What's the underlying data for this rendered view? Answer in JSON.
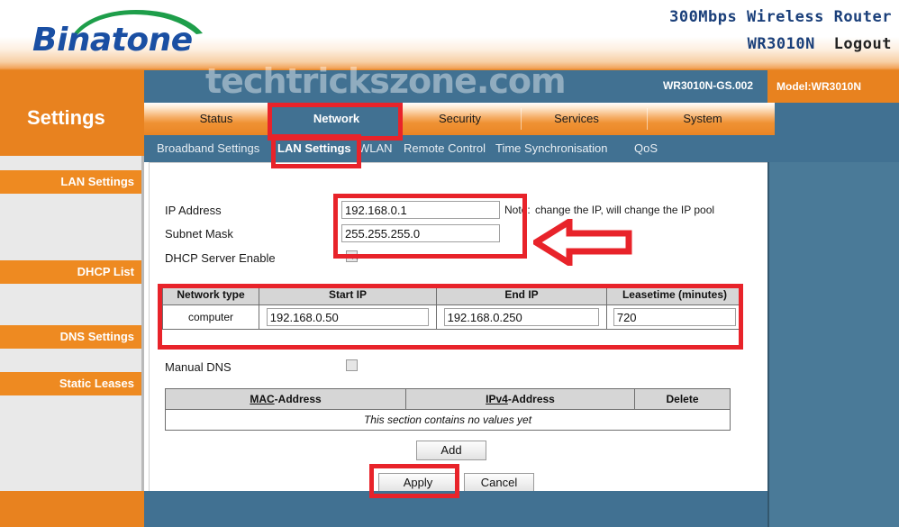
{
  "header": {
    "brand": "Binatone",
    "product_line1": "300Mbps Wireless Router",
    "product_line2": "WR3010N",
    "logout_label": "Logout"
  },
  "titlebar": {
    "watermark": "techtrickszone.com",
    "firmware_version": "WR3010N-GS.002",
    "model_label": "Model:WR3010N"
  },
  "settings_block": {
    "label": "Settings"
  },
  "main_nav": {
    "items": [
      {
        "label": "Status",
        "active": false
      },
      {
        "label": "Network",
        "active": true
      },
      {
        "label": "Security",
        "active": false
      },
      {
        "label": "Services",
        "active": false
      },
      {
        "label": "System",
        "active": false
      }
    ]
  },
  "sub_nav": {
    "items": [
      {
        "label": "Broadband Settings",
        "active": false
      },
      {
        "label": "LAN Settings",
        "active": true
      },
      {
        "label": "WLAN",
        "active": false
      },
      {
        "label": "Remote Control",
        "active": false
      },
      {
        "label": "Time Synchronisation",
        "active": false
      },
      {
        "label": "QoS",
        "active": false
      }
    ]
  },
  "sidebar": {
    "items": [
      {
        "label": "LAN Settings"
      },
      {
        "label": "DHCP List"
      },
      {
        "label": "DNS Settings"
      },
      {
        "label": "Static Leases"
      }
    ]
  },
  "form": {
    "ip_address_label": "IP Address",
    "ip_address_value": "192.168.0.1",
    "subnet_mask_label": "Subnet Mask",
    "subnet_mask_value": "255.255.255.0",
    "dhcp_enable_label": "DHCP Server Enable",
    "dhcp_enable_checked": true,
    "note_prefix": "Note:",
    "note_text": "change the IP, will change the IP pool",
    "manual_dns_label": "Manual DNS",
    "manual_dns_checked": false
  },
  "dhcp_pool_table": {
    "headers": [
      "Network type",
      "Start IP",
      "End IP",
      "Leasetime (minutes)"
    ],
    "rows": [
      {
        "network_type": "computer",
        "start_ip": "192.168.0.50",
        "end_ip": "192.168.0.250",
        "leasetime": "720"
      }
    ]
  },
  "static_leases_table": {
    "headers": [
      "MAC-Address",
      "IPv4-Address",
      "Delete"
    ],
    "header_accesskeys": [
      "MAC",
      "IPv4",
      ""
    ],
    "header_rest": [
      "-Address",
      "-Address",
      "Delete"
    ],
    "empty_message": "This section contains no values yet"
  },
  "buttons": {
    "add": "Add",
    "apply": "Apply",
    "cancel": "Cancel"
  },
  "colors": {
    "orange": "#e8821f",
    "steel_blue": "#417192",
    "panel_blue": "#4a7a98",
    "annotation_red": "#e8232a",
    "brand_blue": "#1a4fa3",
    "logo_green": "#1e9e4a",
    "empty_red": "#d6332c"
  }
}
